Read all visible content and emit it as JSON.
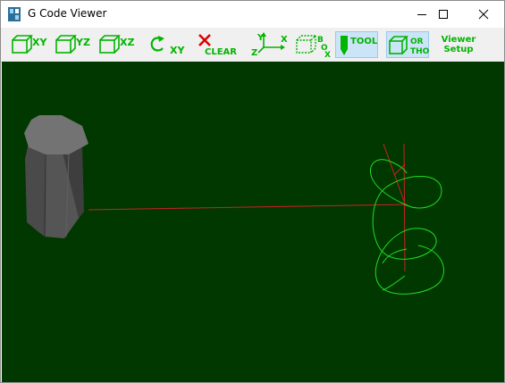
{
  "window": {
    "title": "G Code Viewer",
    "icon": "gcode-viewer-app-icon",
    "controls": [
      "minimize-icon",
      "maximize-icon",
      "close-icon"
    ]
  },
  "toolbar": {
    "view_xy": "XY",
    "view_yz": "YZ",
    "view_xz": "XZ",
    "rotate_xy": "XY",
    "clear": "CLEAR",
    "axes_y": "Y",
    "axes_x": "X",
    "axes_z": "Z",
    "box_b": "B",
    "box_o": "O",
    "box_x": "X",
    "tool": "TOOL",
    "ortho_top": "OR",
    "ortho_bottom": "THO",
    "viewer_setup_1": "Viewer",
    "viewer_setup_2": "Setup",
    "active": [
      "tool",
      "ortho"
    ]
  },
  "colors": {
    "viewport_bg": "#003800",
    "toolpath_green": "#22dd22",
    "toolpath_red": "#cc2222",
    "toolbar_text_green": "#00b400",
    "clear_red": "#e00000"
  }
}
